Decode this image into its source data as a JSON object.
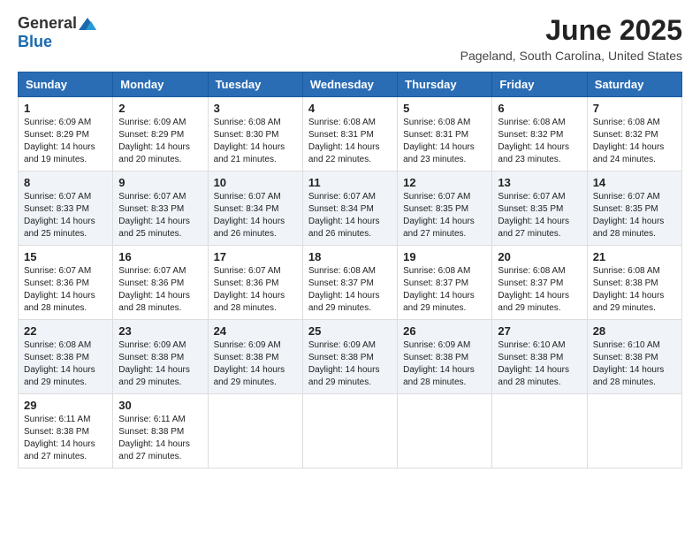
{
  "logo": {
    "general": "General",
    "blue": "Blue"
  },
  "title": "June 2025",
  "location": "Pageland, South Carolina, United States",
  "weekdays": [
    "Sunday",
    "Monday",
    "Tuesday",
    "Wednesday",
    "Thursday",
    "Friday",
    "Saturday"
  ],
  "weeks": [
    [
      {
        "day": "1",
        "sunrise": "6:09 AM",
        "sunset": "8:29 PM",
        "daylight": "14 hours and 19 minutes."
      },
      {
        "day": "2",
        "sunrise": "6:09 AM",
        "sunset": "8:29 PM",
        "daylight": "14 hours and 20 minutes."
      },
      {
        "day": "3",
        "sunrise": "6:08 AM",
        "sunset": "8:30 PM",
        "daylight": "14 hours and 21 minutes."
      },
      {
        "day": "4",
        "sunrise": "6:08 AM",
        "sunset": "8:31 PM",
        "daylight": "14 hours and 22 minutes."
      },
      {
        "day": "5",
        "sunrise": "6:08 AM",
        "sunset": "8:31 PM",
        "daylight": "14 hours and 23 minutes."
      },
      {
        "day": "6",
        "sunrise": "6:08 AM",
        "sunset": "8:32 PM",
        "daylight": "14 hours and 23 minutes."
      },
      {
        "day": "7",
        "sunrise": "6:08 AM",
        "sunset": "8:32 PM",
        "daylight": "14 hours and 24 minutes."
      }
    ],
    [
      {
        "day": "8",
        "sunrise": "6:07 AM",
        "sunset": "8:33 PM",
        "daylight": "14 hours and 25 minutes."
      },
      {
        "day": "9",
        "sunrise": "6:07 AM",
        "sunset": "8:33 PM",
        "daylight": "14 hours and 25 minutes."
      },
      {
        "day": "10",
        "sunrise": "6:07 AM",
        "sunset": "8:34 PM",
        "daylight": "14 hours and 26 minutes."
      },
      {
        "day": "11",
        "sunrise": "6:07 AM",
        "sunset": "8:34 PM",
        "daylight": "14 hours and 26 minutes."
      },
      {
        "day": "12",
        "sunrise": "6:07 AM",
        "sunset": "8:35 PM",
        "daylight": "14 hours and 27 minutes."
      },
      {
        "day": "13",
        "sunrise": "6:07 AM",
        "sunset": "8:35 PM",
        "daylight": "14 hours and 27 minutes."
      },
      {
        "day": "14",
        "sunrise": "6:07 AM",
        "sunset": "8:35 PM",
        "daylight": "14 hours and 28 minutes."
      }
    ],
    [
      {
        "day": "15",
        "sunrise": "6:07 AM",
        "sunset": "8:36 PM",
        "daylight": "14 hours and 28 minutes."
      },
      {
        "day": "16",
        "sunrise": "6:07 AM",
        "sunset": "8:36 PM",
        "daylight": "14 hours and 28 minutes."
      },
      {
        "day": "17",
        "sunrise": "6:07 AM",
        "sunset": "8:36 PM",
        "daylight": "14 hours and 28 minutes."
      },
      {
        "day": "18",
        "sunrise": "6:08 AM",
        "sunset": "8:37 PM",
        "daylight": "14 hours and 29 minutes."
      },
      {
        "day": "19",
        "sunrise": "6:08 AM",
        "sunset": "8:37 PM",
        "daylight": "14 hours and 29 minutes."
      },
      {
        "day": "20",
        "sunrise": "6:08 AM",
        "sunset": "8:37 PM",
        "daylight": "14 hours and 29 minutes."
      },
      {
        "day": "21",
        "sunrise": "6:08 AM",
        "sunset": "8:38 PM",
        "daylight": "14 hours and 29 minutes."
      }
    ],
    [
      {
        "day": "22",
        "sunrise": "6:08 AM",
        "sunset": "8:38 PM",
        "daylight": "14 hours and 29 minutes."
      },
      {
        "day": "23",
        "sunrise": "6:09 AM",
        "sunset": "8:38 PM",
        "daylight": "14 hours and 29 minutes."
      },
      {
        "day": "24",
        "sunrise": "6:09 AM",
        "sunset": "8:38 PM",
        "daylight": "14 hours and 29 minutes."
      },
      {
        "day": "25",
        "sunrise": "6:09 AM",
        "sunset": "8:38 PM",
        "daylight": "14 hours and 29 minutes."
      },
      {
        "day": "26",
        "sunrise": "6:09 AM",
        "sunset": "8:38 PM",
        "daylight": "14 hours and 28 minutes."
      },
      {
        "day": "27",
        "sunrise": "6:10 AM",
        "sunset": "8:38 PM",
        "daylight": "14 hours and 28 minutes."
      },
      {
        "day": "28",
        "sunrise": "6:10 AM",
        "sunset": "8:38 PM",
        "daylight": "14 hours and 28 minutes."
      }
    ],
    [
      {
        "day": "29",
        "sunrise": "6:11 AM",
        "sunset": "8:38 PM",
        "daylight": "14 hours and 27 minutes."
      },
      {
        "day": "30",
        "sunrise": "6:11 AM",
        "sunset": "8:38 PM",
        "daylight": "14 hours and 27 minutes."
      },
      null,
      null,
      null,
      null,
      null
    ]
  ]
}
